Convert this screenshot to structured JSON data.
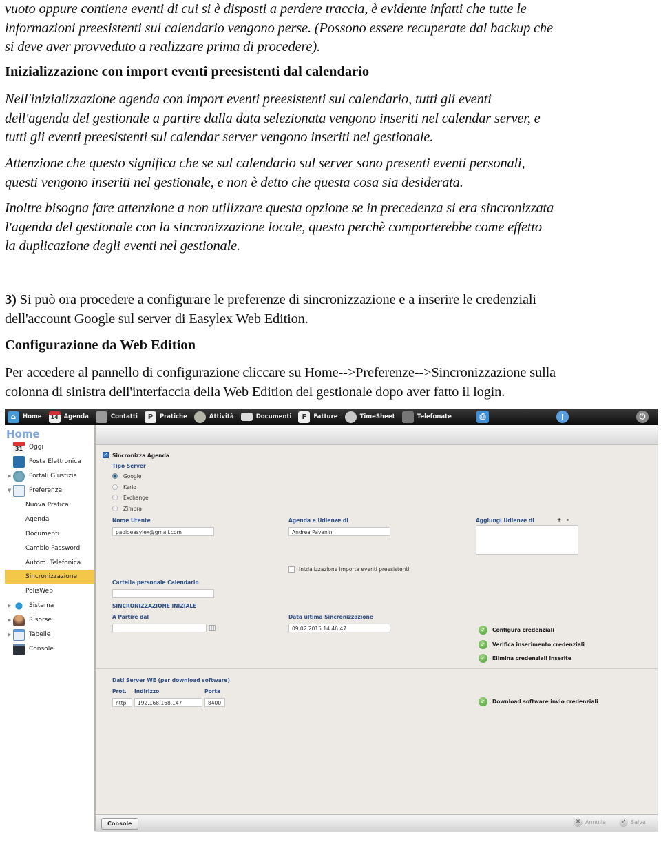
{
  "document": {
    "para1": "vuoto oppure contiene eventi di cui si è disposti a perdere traccia, è evidente infatti che tutte le informazioni preesistenti sul calendario vengono perse. (Possono essere recuperate dal backup che si deve aver provveduto a realizzare prima di procedere).",
    "para1_lines": [
      "vuoto oppure contiene eventi di cui si è disposti a perdere traccia, è evidente infatti che tutte le",
      "informazioni preesistenti sul calendario vengono perse. (Possono essere recuperate dal backup che",
      "si deve aver provveduto a realizzare prima di procedere)."
    ],
    "heading1": "Inizializzazione con import eventi preesistenti dal calendario",
    "para2_lines": [
      "Nell'inizializzazione agenda con import eventi preesistenti sul calendario, tutti gli eventi",
      "dell'agenda del gestionale a partire dalla data selezionata vengono inseriti nel calendar server, e",
      "tutti gli eventi preesistenti sul calendar server vengono inseriti nel gestionale."
    ],
    "para3_lines": [
      "Attenzione che questo significa che se sul calendario sul server sono presenti eventi personali,",
      "questi vengono inseriti nel gestionale, e non è detto che questa cosa sia desiderata."
    ],
    "para4_lines": [
      "Inoltre bisogna fare attenzione a non utilizzare questa opzione se in precedenza si era sincronizzata",
      "l'agenda del gestionale con la sincronizzazione locale, questo perchè comporterebbe come effetto",
      "la duplicazione degli eventi nel gestionale."
    ],
    "step3_number": "3)",
    "step3_lines": [
      " Si può ora procedere a configurare le preferenze di sincronizzazione e a inserire le credenziali",
      "dell'account Google sul server di Easylex Web Edition."
    ],
    "heading2": "Configurazione da  Web Edition",
    "para5_lines": [
      "Per accedere al pannello di configurazione cliccare su Home-->Preferenze-->Sincronizzazione sulla",
      "colonna di sinistra dell'interfaccia della Web Edition del gestionale dopo aver fatto il login."
    ]
  },
  "app": {
    "topbar": {
      "items": [
        {
          "label": "Home",
          "icon": "home-icon"
        },
        {
          "label": "Agenda",
          "icon": "calendar-icon",
          "icon_text": "14"
        },
        {
          "label": "Contatti",
          "icon": "contacts-icon"
        },
        {
          "label": "Pratiche",
          "icon": "pratiche-icon",
          "icon_text": "P"
        },
        {
          "label": "Attività",
          "icon": "activity-icon"
        },
        {
          "label": "Documenti",
          "icon": "envelope-icon"
        },
        {
          "label": "Fatture",
          "icon": "fatture-icon",
          "icon_text": "F"
        },
        {
          "label": "TimeSheet",
          "icon": "clock-icon"
        },
        {
          "label": "Telefonate",
          "icon": "phone-icon"
        }
      ],
      "right_icons": [
        "printer-icon",
        "info-icon",
        "power-icon"
      ]
    },
    "sidebar": {
      "title": "Home",
      "items": [
        {
          "label": "Oggi",
          "icon": "calendar-31-icon",
          "icon_text": "31",
          "expander": ""
        },
        {
          "label": "Posta Elettronica",
          "icon": "mail-icon",
          "expander": ""
        },
        {
          "label": "Portali Giustizia",
          "icon": "globe-icon",
          "expander": "▶"
        },
        {
          "label": "Preferenze",
          "icon": "preferences-icon",
          "expander": "▼"
        },
        {
          "label": "Nuova Pratica",
          "sub": true
        },
        {
          "label": "Agenda",
          "sub": true
        },
        {
          "label": "Documenti",
          "sub": true
        },
        {
          "label": "Cambio Password",
          "sub": true
        },
        {
          "label": "Autom. Telefonica",
          "sub": true
        },
        {
          "label": "Sincronizzazione",
          "sub": true,
          "active": true
        },
        {
          "label": "PolisWeb",
          "sub": true
        },
        {
          "label": "Sistema",
          "icon": "gears-icon",
          "expander": "▶"
        },
        {
          "label": "Risorse",
          "icon": "users-icon",
          "expander": "▶"
        },
        {
          "label": "Tabelle",
          "icon": "table-icon",
          "expander": "▶"
        },
        {
          "label": "Console",
          "icon": "console-icon",
          "expander": ""
        }
      ],
      "active_color": "#f4c64a"
    },
    "form": {
      "sync_agenda_label": "Sincronizza Agenda",
      "sync_agenda_checked": true,
      "server_type_label": "Tipo Server",
      "server_types": [
        {
          "label": "Google",
          "selected": true
        },
        {
          "label": "Kerio",
          "selected": false
        },
        {
          "label": "Exchange",
          "selected": false
        },
        {
          "label": "Zimbra",
          "selected": false
        }
      ],
      "username_label": "Nome Utente",
      "username_value": "paoloeasylex@gmail.com",
      "agenda_label": "Agenda e Udienze di",
      "agenda_value": "Andrea Pavanini",
      "add_hearings_label": "Aggiungi Udienze di",
      "add_symbol": "+",
      "remove_symbol": "-",
      "init_import_label": "Inizializzazione importa eventi preesistenti",
      "init_import_checked": false,
      "calendar_folder_label": "Cartella personale Calendario",
      "calendar_folder_value": "",
      "initial_sync_header": "SINCRONIZZAZIONE INIZIALE",
      "start_from_label": "A Partire dal",
      "start_from_value": "",
      "last_sync_label": "Data ultima Sincronizzazione",
      "last_sync_value": "09.02.2015 14:46:47",
      "actions": [
        "Configura credenziali",
        "Verifica inserimento credenziali",
        "Elimina credenziali inserite"
      ],
      "server_data_header": "Dati Server WE (per download software)",
      "prot_label": "Prot.",
      "address_label": "Indirizzo",
      "port_label": "Porta",
      "prot_value": "http",
      "address_value": "192.168.168.147",
      "port_value": "8400",
      "download_action": "Download software invio credenziali"
    },
    "footer": {
      "console_label": "Console",
      "cancel_label": "Annulla",
      "save_label": "Salva"
    },
    "colors": {
      "label_blue": "#2d4f86",
      "panel_bg": "#edeae5",
      "ok_green": "#3f9a2c"
    }
  }
}
